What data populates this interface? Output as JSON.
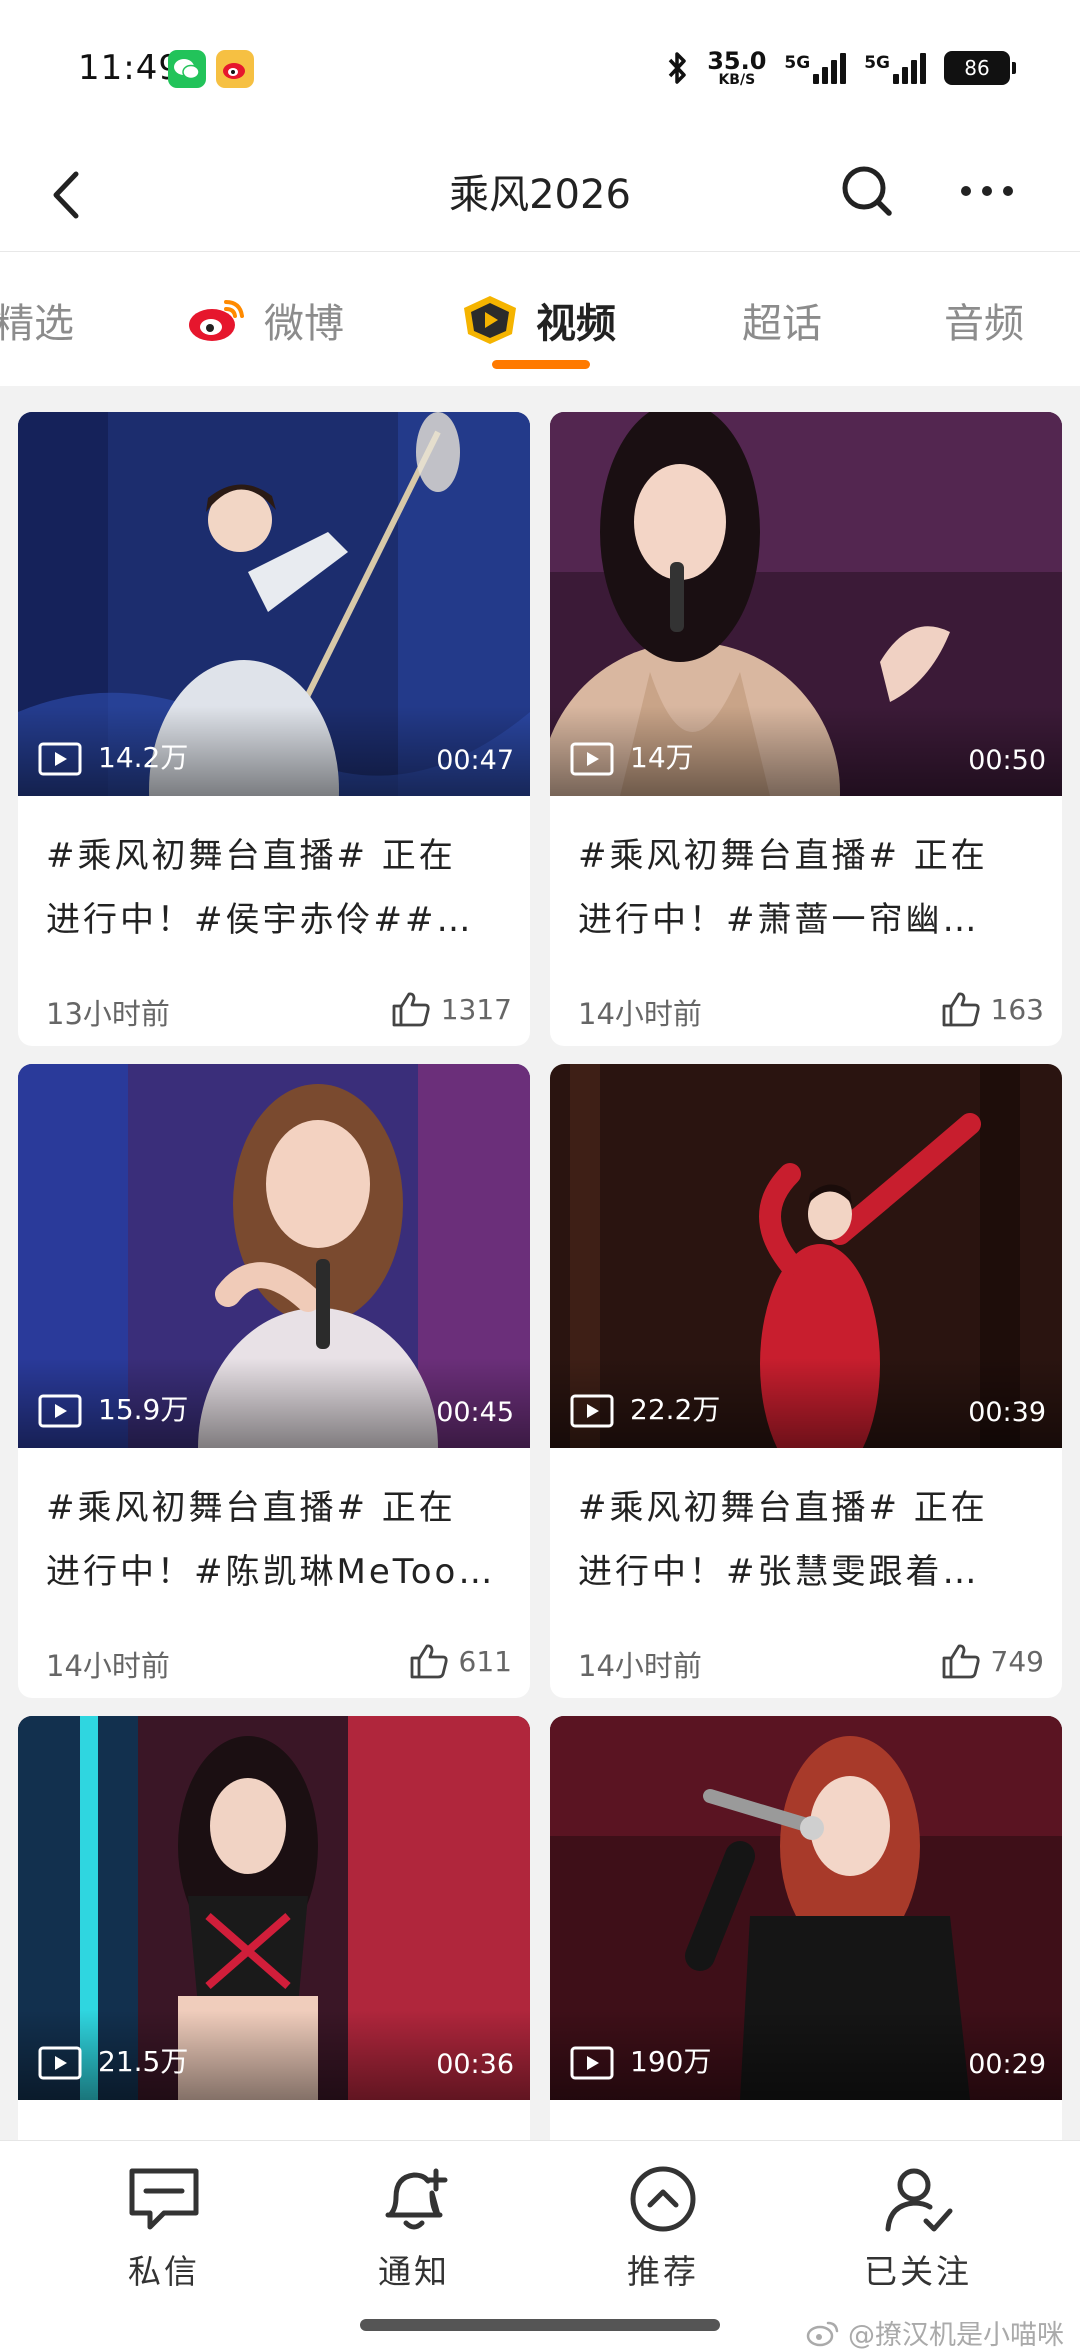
{
  "status_bar": {
    "time": "11:49",
    "net_speed": "35.0",
    "net_speed_unit": "KB/S",
    "network_1": "5G",
    "network_2": "5G",
    "battery": "86"
  },
  "header": {
    "title": "乘风2026",
    "back_icon": "chevron-left-icon",
    "search_icon": "search-icon",
    "more_icon": "more-horizontal-icon"
  },
  "tabs": [
    {
      "label": "精选",
      "active": false
    },
    {
      "label": "微博",
      "active": false,
      "icon": "weibo-logo-icon"
    },
    {
      "label": "视频",
      "active": true,
      "icon": "video-badge-icon"
    },
    {
      "label": "超话",
      "active": false
    },
    {
      "label": "音频",
      "active": false
    }
  ],
  "accent_color": "#ff7a00",
  "cards": [
    {
      "views": "14.2万",
      "duration": "00:47",
      "caption_line1": "#乘风初舞台直播# 正在",
      "caption_line2": "进行中！#侯宇赤伶##…",
      "time": "13小时前",
      "likes": "1317"
    },
    {
      "views": "14万",
      "duration": "00:50",
      "caption_line1": "#乘风初舞台直播# 正在",
      "caption_line2": "进行中！#萧蔷一帘幽…",
      "time": "14小时前",
      "likes": "163"
    },
    {
      "views": "15.9万",
      "duration": "00:45",
      "caption_line1": "#乘风初舞台直播# 正在",
      "caption_line2": "进行中！#陈凯琳MeToo…",
      "time": "14小时前",
      "likes": "611"
    },
    {
      "views": "22.2万",
      "duration": "00:39",
      "caption_line1": "#乘风初舞台直播# 正在",
      "caption_line2": "进行中！#张慧雯跟着…",
      "time": "14小时前",
      "likes": "749"
    },
    {
      "views": "21.5万",
      "duration": "00:36",
      "caption_line1": "",
      "caption_line2": "",
      "time": "",
      "likes": ""
    },
    {
      "views": "190万",
      "duration": "00:29",
      "caption_line1": "",
      "caption_line2": "",
      "time": "",
      "likes": ""
    }
  ],
  "bottom_nav": [
    {
      "label": "私信",
      "icon": "message-icon"
    },
    {
      "label": "通知",
      "icon": "bell-plus-icon"
    },
    {
      "label": "推荐",
      "icon": "chevron-up-circle-icon"
    },
    {
      "label": "已关注",
      "icon": "user-check-icon"
    }
  ],
  "watermark": "@撩汉机是小喵咪"
}
